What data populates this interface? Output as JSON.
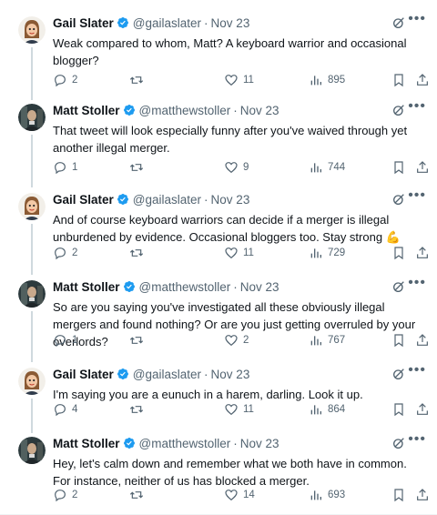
{
  "tweets": [
    {
      "name": "Gail Slater",
      "handle": "@gailaslater",
      "date": "Nov 23",
      "dot": "·",
      "text": "Weak compared to whom, Matt? A keyboard warrior and occasional blogger?",
      "replies": "2",
      "retweets": "",
      "likes": "11",
      "views": "895",
      "avatar": "gail"
    },
    {
      "name": "Matt Stoller",
      "handle": "@matthewstoller",
      "date": "Nov 23",
      "dot": "·",
      "text": "That tweet will look especially funny after you've waived through yet another illegal merger.",
      "replies": "1",
      "retweets": "",
      "likes": "9",
      "views": "744",
      "avatar": "matt"
    },
    {
      "name": "Gail Slater",
      "handle": "@gailaslater",
      "date": "Nov 23",
      "dot": "·",
      "text": "And of course keyboard warriors can decide if a merger is illegal unburdened by evidence. Occasional bloggers too. Stay strong 💪",
      "replies": "2",
      "retweets": "",
      "likes": "11",
      "views": "729",
      "avatar": "gail"
    },
    {
      "name": "Matt Stoller",
      "handle": "@matthewstoller",
      "date": "Nov 23",
      "dot": "·",
      "text": "So are you saying you've investigated all these obviously illegal mergers and found nothing? Or are you just getting overruled by your overlords?",
      "replies": "1",
      "retweets": "",
      "likes": "2",
      "views": "767",
      "avatar": "matt"
    },
    {
      "name": "Gail Slater",
      "handle": "@gailaslater",
      "date": "Nov 23",
      "dot": "·",
      "text": "I'm saying you are a eunuch in a harem, darling. Look it up.",
      "replies": "4",
      "retweets": "",
      "likes": "11",
      "views": "864",
      "avatar": "gail"
    },
    {
      "name": "Matt Stoller",
      "handle": "@matthewstoller",
      "date": "Nov 23",
      "dot": "·",
      "text": "Hey, let's calm down and remember what we both have in common. For instance, neither of us has blocked a merger.",
      "replies": "2",
      "retweets": "",
      "likes": "14",
      "views": "693",
      "avatar": "matt"
    }
  ],
  "colors": {
    "text": "#0f1419",
    "muted": "#536471",
    "verified": "#1d9bf0",
    "line": "#cfd9de"
  },
  "icons": [
    "verified-badge-icon",
    "grok-icon",
    "more-icon",
    "reply-icon",
    "retweet-icon",
    "like-icon",
    "views-icon",
    "bookmark-icon",
    "share-icon"
  ]
}
